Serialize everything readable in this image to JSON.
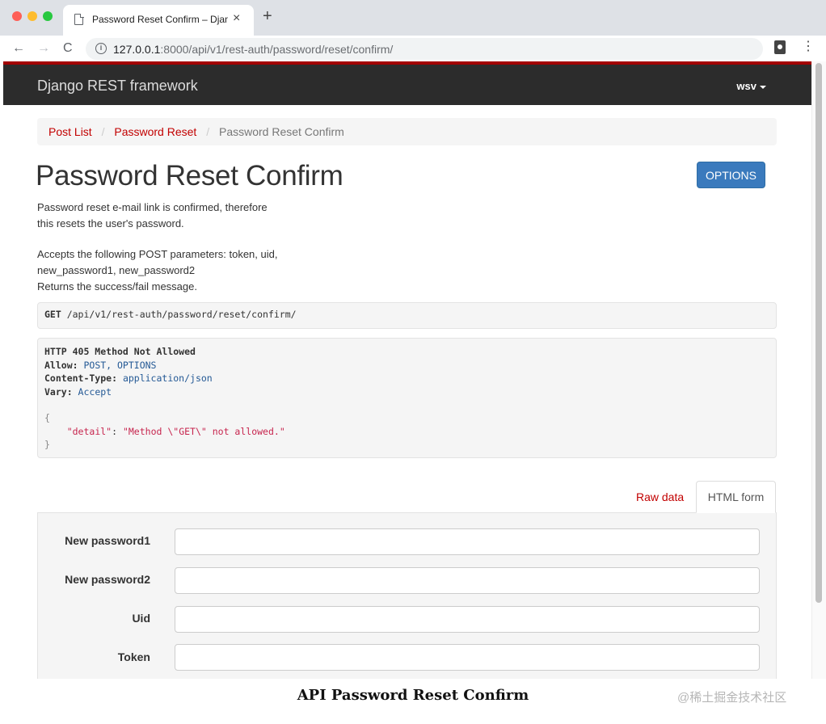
{
  "browser": {
    "tab_title": "Password Reset Confirm – Djan",
    "tab_close": "×",
    "new_tab": "+",
    "url_host": "127.0.0.1",
    "url_rest": ":8000/api/v1/rest-auth/password/reset/confirm/",
    "icons": {
      "back": "←",
      "forward": "→",
      "reload": "C",
      "info": "i",
      "menu": "⋮"
    }
  },
  "navbar": {
    "brand": "Django REST framework",
    "user": "wsv"
  },
  "breadcrumb": {
    "items": [
      "Post List",
      "Password Reset"
    ],
    "active": "Password Reset Confirm",
    "separator": "/"
  },
  "page": {
    "title": "Password Reset Confirm",
    "options_label": "OPTIONS",
    "description": [
      "Password reset e-mail link is confirmed, therefore",
      "this resets the user's password.",
      "Accepts the following POST parameters: token, uid,",
      "new_password1, new_password2",
      "Returns the success/fail message."
    ]
  },
  "request": {
    "method": "GET",
    "path": " /api/v1/rest-auth/password/reset/confirm/"
  },
  "response": {
    "status": "HTTP 405 Method Not Allowed",
    "headers": [
      {
        "name": "Allow:",
        "value": " POST, OPTIONS"
      },
      {
        "name": "Content-Type:",
        "value": " application/json"
      },
      {
        "name": "Vary:",
        "value": " Accept"
      }
    ],
    "body_open": "{",
    "body_key": "\"detail\"",
    "body_colon": ": ",
    "body_value": "\"Method \\\"GET\\\" not allowed.\"",
    "body_close": "}"
  },
  "form_tabs": {
    "raw": "Raw data",
    "html": "HTML form"
  },
  "form": {
    "fields": [
      {
        "label": "New password1",
        "value": ""
      },
      {
        "label": "New password2",
        "value": ""
      },
      {
        "label": "Uid",
        "value": ""
      },
      {
        "label": "Token",
        "value": ""
      }
    ]
  },
  "caption": "API Password Reset Confirm",
  "watermark": "@稀土掘金技术社区",
  "colors": {
    "navbar_bg": "#2c2c2c",
    "navbar_accent": "#a30000",
    "link": "#c20000",
    "options_button": "#3a7abd",
    "json_string": "#c7254e",
    "header_value": "#245995"
  }
}
